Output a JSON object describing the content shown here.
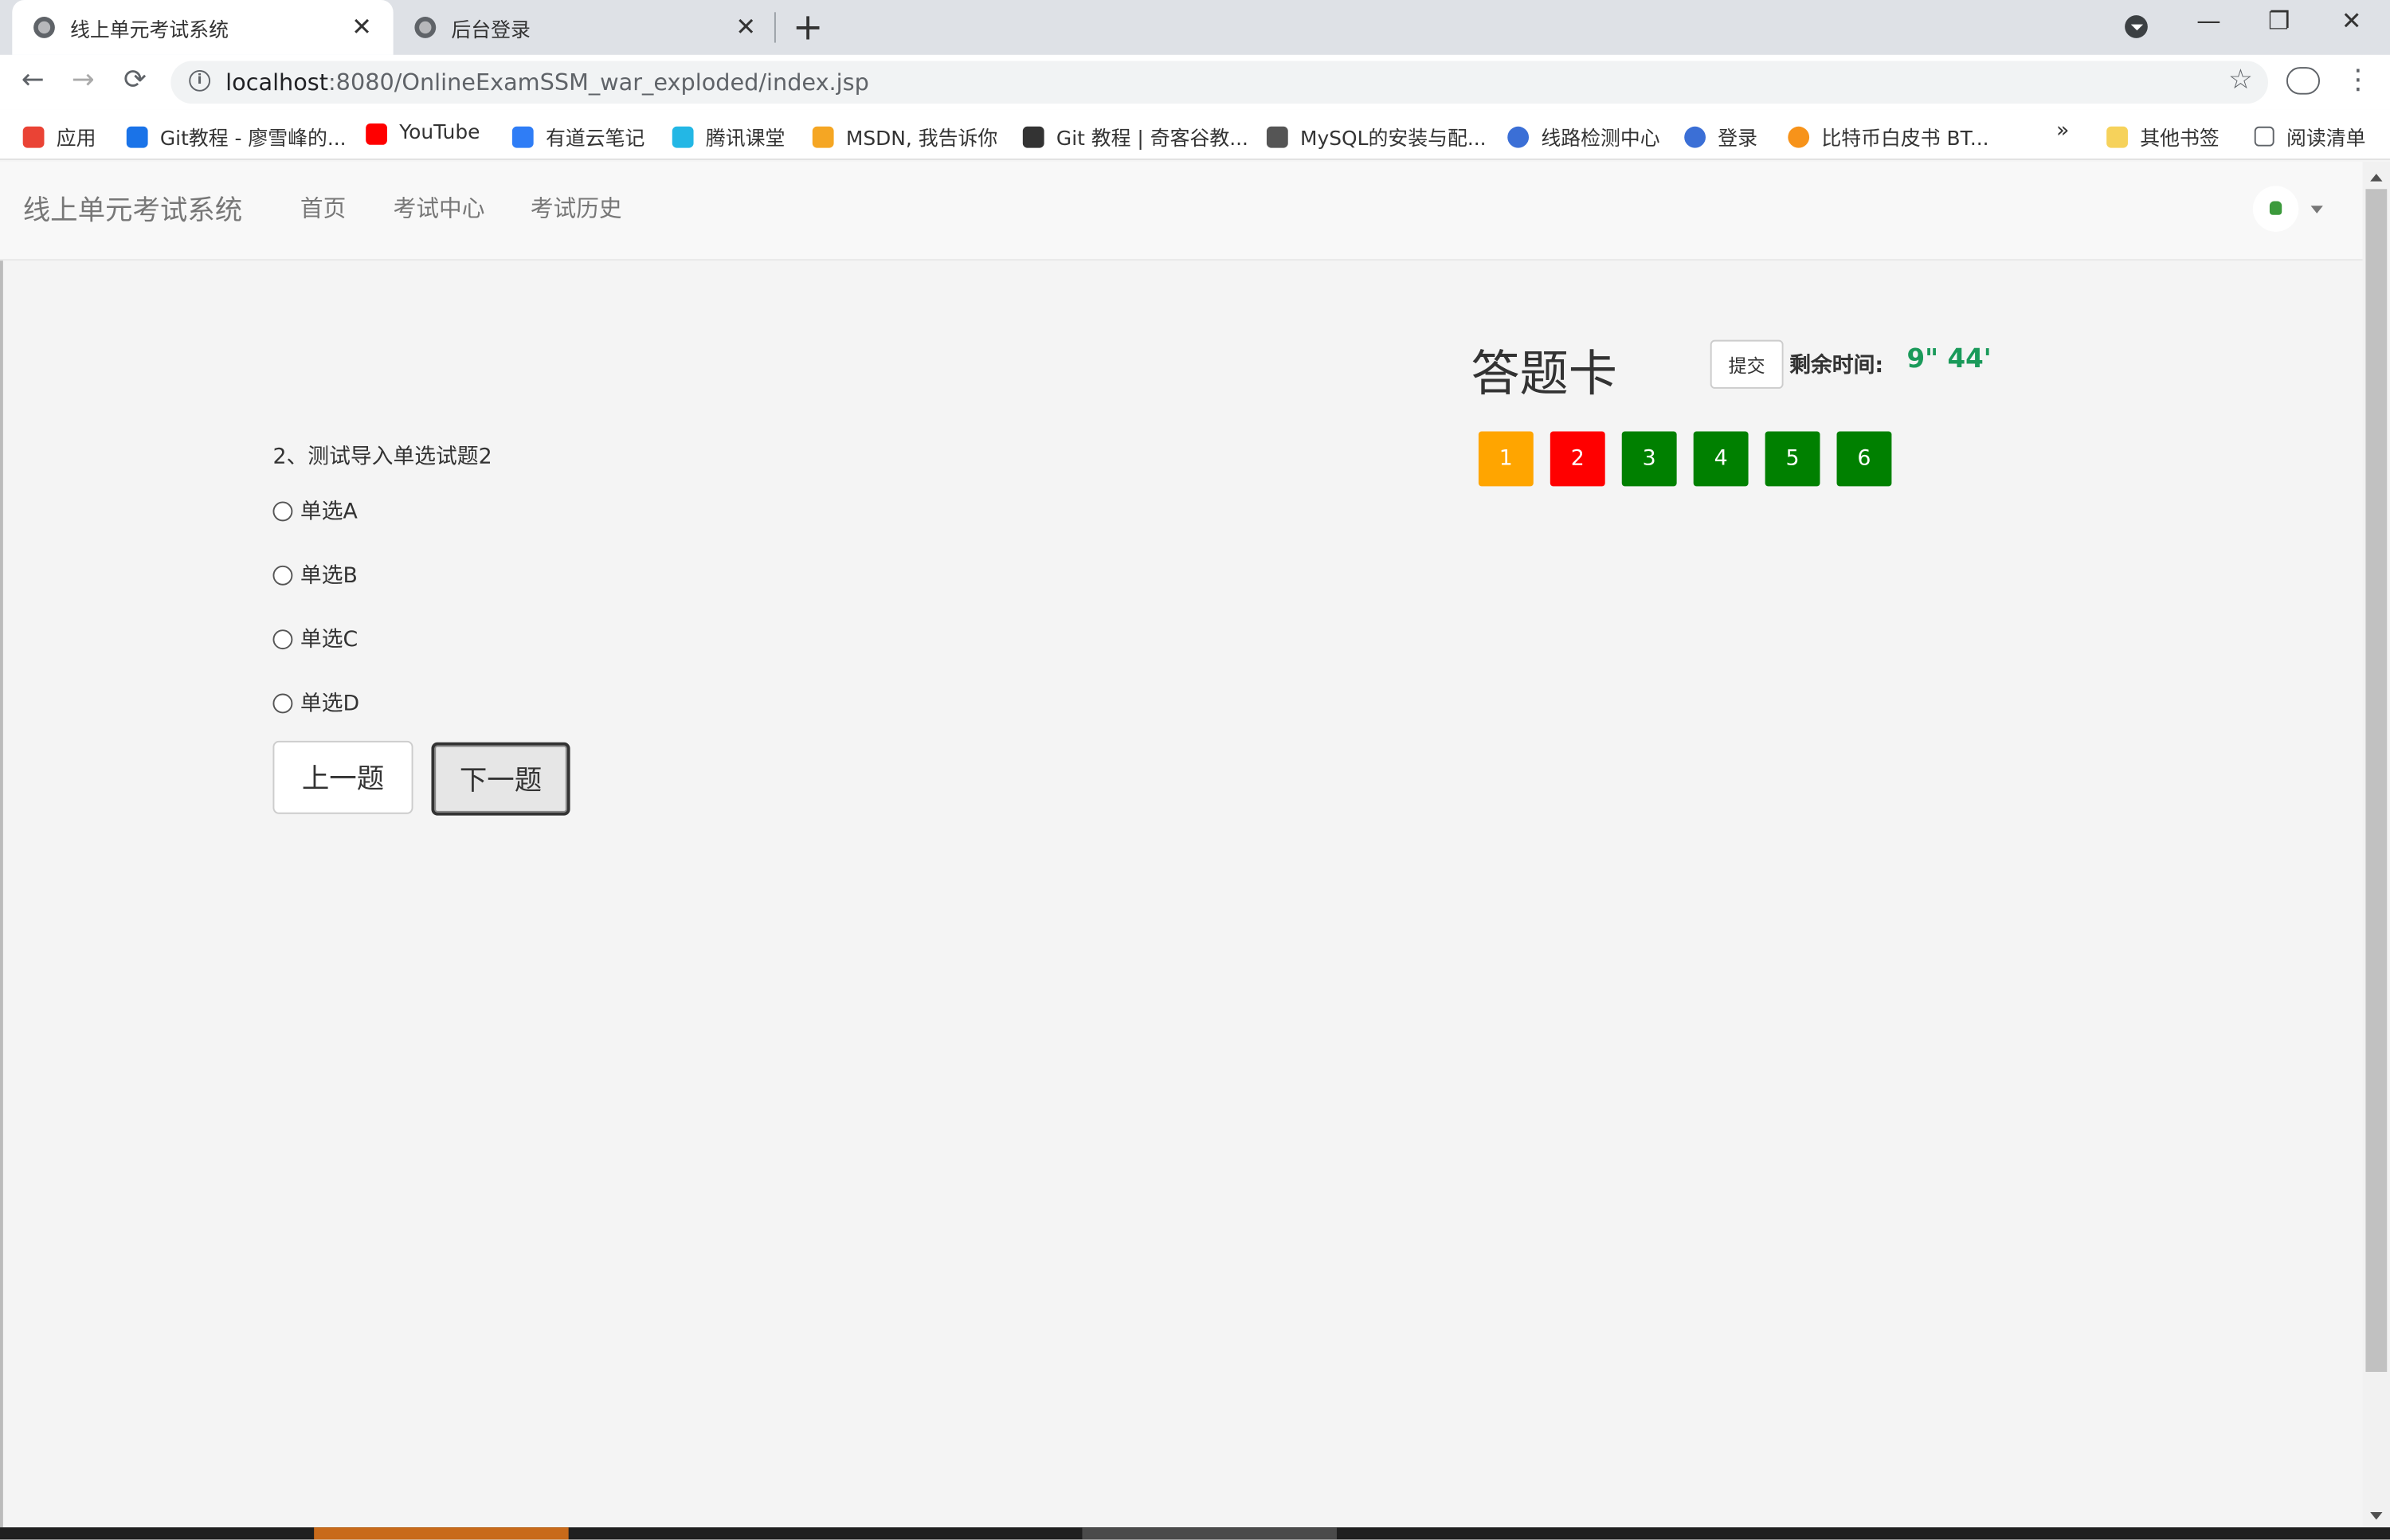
{
  "browser": {
    "tabs": [
      {
        "title": "线上单元考试系统",
        "active": true
      },
      {
        "title": "后台登录",
        "active": false
      }
    ],
    "new_tab": "+",
    "close_glyph": "✕",
    "window_controls": {
      "minimize": "—",
      "restore": "❐",
      "close": "✕"
    },
    "url_host": "localhost",
    "url_rest": ":8080/OnlineExamSSM_war_exploded/index.jsp",
    "bookmarks": [
      {
        "label": "应用",
        "icon": "apps-grid-icon",
        "color": "#ea4335"
      },
      {
        "label": "Git教程 - 廖雪峰的...",
        "icon": "rocket-icon",
        "color": "#1a73e8"
      },
      {
        "label": "YouTube",
        "icon": "youtube-icon",
        "color": "#ff0000"
      },
      {
        "label": "有道云笔记",
        "icon": "youdao-note-icon",
        "color": "#2f7df6"
      },
      {
        "label": "腾讯课堂",
        "icon": "tencent-classroom-icon",
        "color": "#23b7e5"
      },
      {
        "label": "MSDN, 我告诉你",
        "icon": "msdn-icon",
        "color": "#f5a623"
      },
      {
        "label": "Git 教程 | 奇客谷教...",
        "icon": "qikegu-icon",
        "color": "#333333"
      },
      {
        "label": "MySQL的安装与配...",
        "icon": "mysql-icon",
        "color": "#555555"
      },
      {
        "label": "线路检测中心",
        "icon": "globe-blue-icon",
        "color": "#3b6fd6"
      },
      {
        "label": "登录",
        "icon": "globe-blue-icon",
        "color": "#3b6fd6"
      },
      {
        "label": "比特币白皮书 BT...",
        "icon": "bitcoin-icon",
        "color": "#f7931a"
      }
    ],
    "bookmark_more": "»",
    "other_bookmarks": "其他书签",
    "reading_list": "阅读清单"
  },
  "navbar": {
    "brand": "线上单元考试系统",
    "links": [
      "首页",
      "考试中心",
      "考试历史"
    ]
  },
  "question": {
    "title": "2、测试导入单选试题2",
    "options": [
      "单选A",
      "单选B",
      "单选C",
      "单选D"
    ],
    "prev_label": "上一题",
    "next_label": "下一题"
  },
  "answer_card": {
    "title": "答题卡",
    "submit_label": "提交",
    "remaining_label": "剩余时间:",
    "remaining_time": "9\" 44'",
    "numbers": [
      {
        "label": "1",
        "color": "#ffa500"
      },
      {
        "label": "2",
        "color": "#ff0000"
      },
      {
        "label": "3",
        "color": "#008000"
      },
      {
        "label": "4",
        "color": "#008000"
      },
      {
        "label": "5",
        "color": "#008000"
      },
      {
        "label": "6",
        "color": "#008000"
      }
    ]
  }
}
